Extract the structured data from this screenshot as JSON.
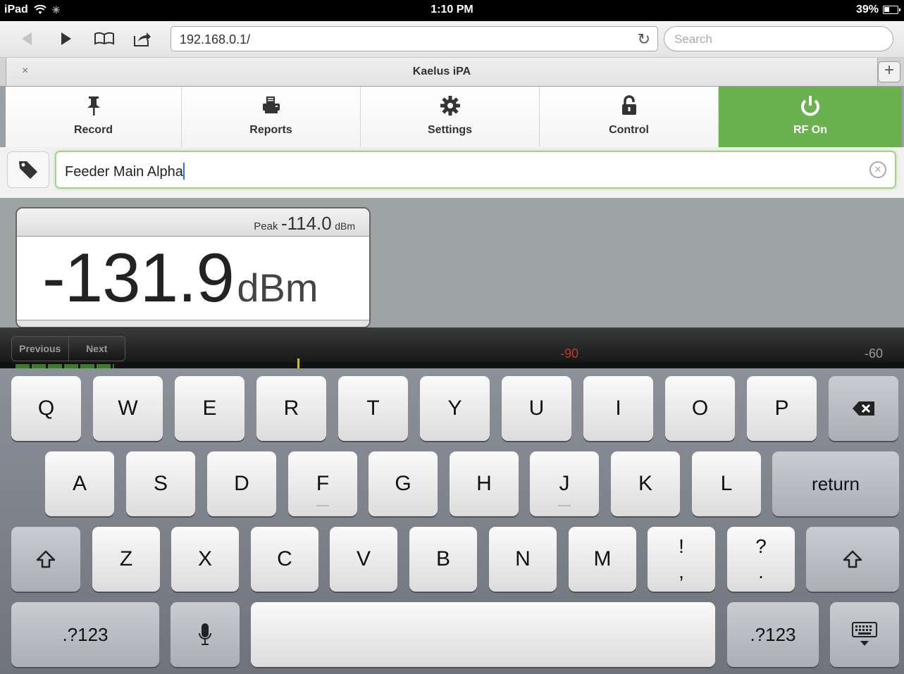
{
  "status_bar": {
    "device": "iPad",
    "time": "1:10 PM",
    "battery": "39%"
  },
  "browser": {
    "url": "192.168.0.1/",
    "search_placeholder": "Search",
    "tab_title": "Kaelus iPA",
    "tab_close": "×",
    "new_tab": "+"
  },
  "nav": {
    "items": [
      {
        "label": "Record",
        "icon": "pin-icon"
      },
      {
        "label": "Reports",
        "icon": "printer-icon"
      },
      {
        "label": "Settings",
        "icon": "gear-icon"
      },
      {
        "label": "Control",
        "icon": "lock-icon"
      },
      {
        "label": "RF On",
        "icon": "power-icon",
        "active": true
      }
    ],
    "active_color": "#6ab150"
  },
  "tag_field": {
    "value": "Feeder Main Alpha"
  },
  "reading": {
    "peak_label": "Peak",
    "peak_value": "-114.0",
    "peak_unit": "dBm",
    "value": "-131.9",
    "unit": "dBm"
  },
  "form_assistant": {
    "previous": "Previous",
    "next": "Next",
    "scale_left": "-90",
    "scale_right": "-60"
  },
  "keyboard": {
    "row1": [
      "Q",
      "W",
      "E",
      "R",
      "T",
      "Y",
      "U",
      "I",
      "O",
      "P"
    ],
    "row2": [
      "A",
      "S",
      "D",
      "F",
      "G",
      "H",
      "J",
      "K",
      "L"
    ],
    "return": "return",
    "row3": [
      "Z",
      "X",
      "C",
      "V",
      "B",
      "N",
      "M"
    ],
    "punct1_top": "!",
    "punct1_bottom": ",",
    "punct2_top": "?",
    "punct2_bottom": ".",
    "numbers": ".?123"
  }
}
